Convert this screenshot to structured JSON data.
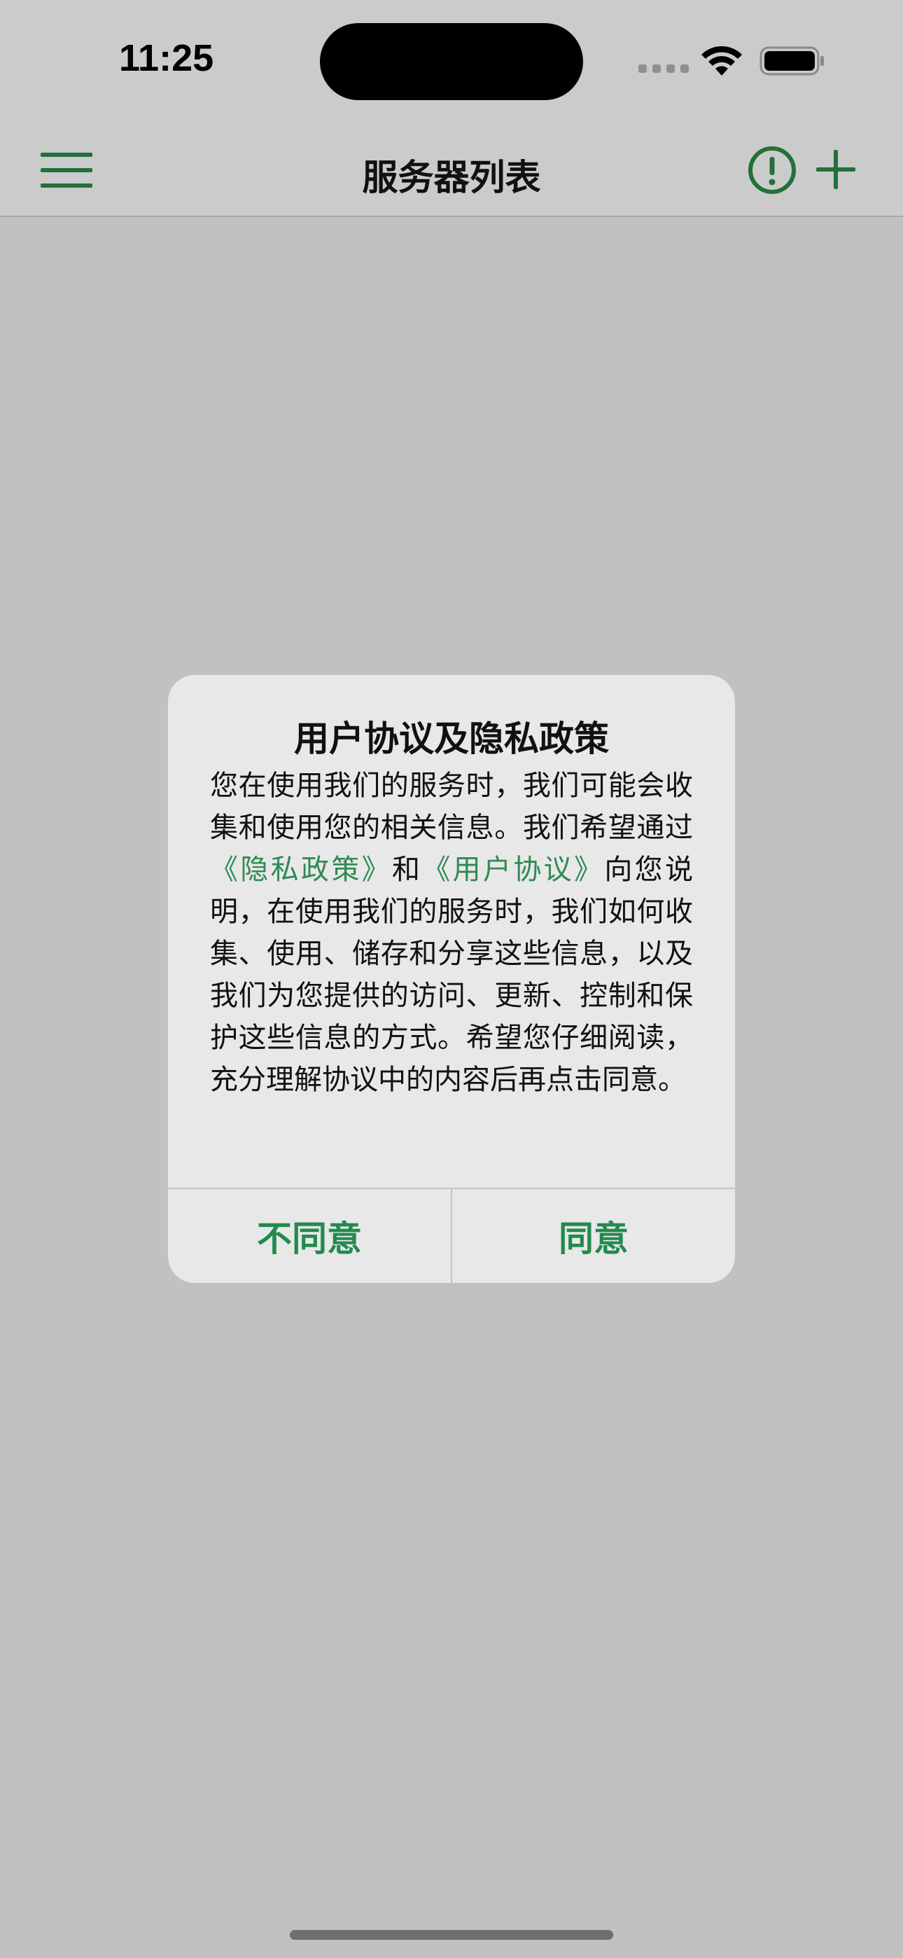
{
  "status_bar": {
    "time": "11:25"
  },
  "nav": {
    "title": "服务器列表",
    "menu_icon": "hamburger-menu-icon",
    "info_icon": "exclamation-circle-icon",
    "add_icon": "plus-icon"
  },
  "dialog": {
    "title": "用户协议及隐私政策",
    "message": {
      "part1": "您在使用我们的服务时，我们可能会收集和使用您的相关信息。我们希望通过",
      "privacy_link": "《隐私政策》",
      "part2": "和",
      "agreement_link": "《用户协议》",
      "part3": "向您说明，在使用我们的服务时，我们如何收集、使用、储存和分享这些信息，以及我们为您提供的访问、更新、控制和保护这些信息的方式。希望您仔细阅读，充分理解协议中的内容后再点击同意。"
    },
    "disagree_label": "不同意",
    "agree_label": "同意"
  },
  "colors": {
    "accent_green": "#228a4d",
    "link_green": "#2f8a53",
    "icon_green": "#23703c",
    "backdrop": "#c1c1c1"
  }
}
